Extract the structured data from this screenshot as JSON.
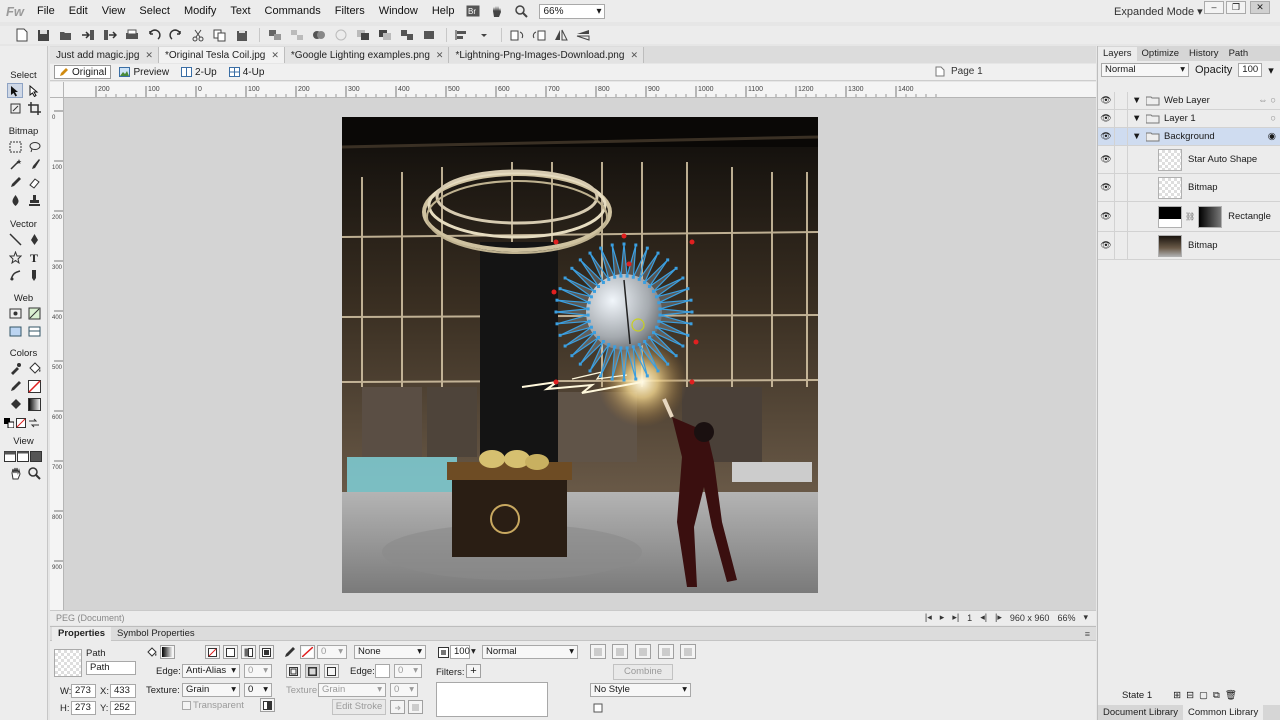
{
  "app": {
    "logo": "Fw",
    "menus": [
      "File",
      "Edit",
      "View",
      "Select",
      "Modify",
      "Text",
      "Commands",
      "Filters",
      "Window",
      "Help"
    ],
    "zoom": "66%",
    "workspace_mode": "Expanded Mode",
    "window_buttons": [
      "–",
      "❐",
      "✕"
    ]
  },
  "tools": {
    "headings": {
      "select": "Select",
      "bitmap": "Bitmap",
      "vector": "Vector",
      "web": "Web",
      "colors": "Colors",
      "view": "View"
    }
  },
  "documents": {
    "tabs": [
      {
        "label": "Just add magic.jpg",
        "active": false
      },
      {
        "label": "*Original Tesla Coil.jpg",
        "active": true
      },
      {
        "label": "*Google Lighting examples.png",
        "active": false
      },
      {
        "label": "*Lightning-Png-Images-Download.png",
        "active": false
      }
    ]
  },
  "viewbar": {
    "original": "Original",
    "preview": "Preview",
    "two_up": "2-Up",
    "four_up": "4-Up",
    "page": "Page 1"
  },
  "rulers": {
    "top_labels": [
      "200",
      "100",
      "0",
      "100",
      "200",
      "300",
      "400",
      "500",
      "600",
      "700",
      "800",
      "900",
      "1000",
      "1100",
      "1200",
      "1300",
      "1400"
    ],
    "left_labels": [
      "0",
      "100",
      "200",
      "300",
      "400",
      "500",
      "600",
      "700",
      "800",
      "900"
    ]
  },
  "status": {
    "doc_type": "PEG (Document)",
    "frame": "1",
    "canvas_size": "960 x 960",
    "zoom": "66%"
  },
  "properties": {
    "tabs": {
      "properties": "Properties",
      "symbol": "Symbol Properties"
    },
    "object_type": "Path",
    "object_name": "Path",
    "w_label": "W:",
    "w": "273",
    "h_label": "H:",
    "h": "273",
    "x_label": "X:",
    "x": "433",
    "y_label": "Y:",
    "y": "252",
    "edge_label": "Edge:",
    "edge_value": "Anti-Alias",
    "edge_amount": "0",
    "texture_label": "Texture:",
    "texture_value": "Grain",
    "texture_amount": "0",
    "transparent_label": "Transparent",
    "stroke_size": "0",
    "stroke_type": "None",
    "stroke_edge_label": "Edge:",
    "stroke_edge_amount": "0",
    "stroke_texture_label": "Texture:",
    "stroke_texture_value": "Grain",
    "stroke_texture_amount": "0",
    "edit_stroke": "Edit Stroke",
    "opacity": "100",
    "blend": "Normal",
    "filters_label": "Filters:",
    "filters_add": "+",
    "combine": "Combine",
    "style": "No Style"
  },
  "right_panel": {
    "tabs": [
      "Layers",
      "Optimize",
      "History",
      "Path"
    ],
    "blend": "Normal",
    "opacity_label": "Opacity",
    "opacity": "100",
    "layers": [
      {
        "name": "Web Layer",
        "type": "folder",
        "selected": false
      },
      {
        "name": "Layer 1",
        "type": "folder",
        "selected": false
      },
      {
        "name": "Background",
        "type": "folder",
        "selected": true
      },
      {
        "name": "Star Auto Shape",
        "type": "object",
        "selected": false
      },
      {
        "name": "Bitmap",
        "type": "object",
        "selected": false
      },
      {
        "name": "Rectangle",
        "type": "object",
        "selected": false
      },
      {
        "name": "Bitmap",
        "type": "object",
        "selected": false
      }
    ],
    "state": "State 1",
    "library_tabs": [
      "Document Library",
      "Common Library"
    ]
  },
  "colors": {
    "accent": "#8ea3c4",
    "selection_blue": "#3b9fe0",
    "handle_red": "#e02020",
    "panel_bg": "#ececec"
  }
}
